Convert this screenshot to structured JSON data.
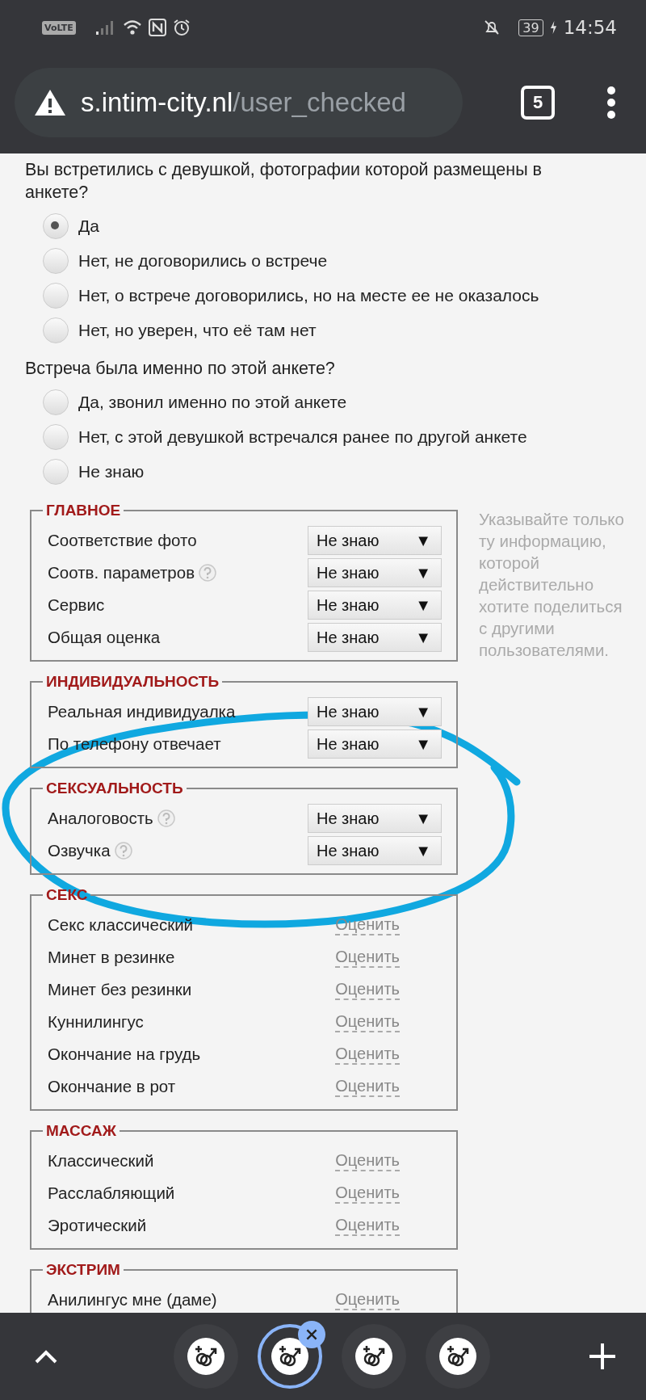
{
  "status_bar": {
    "network_badge": "VoLTE",
    "battery": "39",
    "time": "14:54"
  },
  "address_bar": {
    "domain": "s.intim-city.nl",
    "path": "/user_checked",
    "tab_count": "5"
  },
  "questions": [
    {
      "text": "Вы встретились с девушкой, фотографии которой размещены в анкете?",
      "options": [
        {
          "label": "Да",
          "selected": true
        },
        {
          "label": "Нет, не договорились о встрече",
          "selected": false
        },
        {
          "label": "Нет, о встрече договорились, но на месте ее не оказалось",
          "selected": false
        },
        {
          "label": "Нет, но уверен, что её там нет",
          "selected": false
        }
      ]
    },
    {
      "text": "Встреча была именно по этой анкете?",
      "options": [
        {
          "label": "Да, звонил именно по этой анкете",
          "selected": false
        },
        {
          "label": "Нет, с этой девушкой встречался ранее по другой анкете",
          "selected": false
        },
        {
          "label": "Не знаю",
          "selected": false
        }
      ]
    }
  ],
  "side_note": "Указывайте только ту информацию, которой действительно хотите поделиться с другими пользователями.",
  "sections": [
    {
      "title": "ГЛАВНОЕ",
      "rows": [
        {
          "label": "Соответствие фото",
          "kind": "select",
          "value": "Не знаю",
          "arrow": "▼"
        },
        {
          "label": "Соотв. параметров",
          "help": true,
          "kind": "select",
          "value": "Не знаю",
          "arrow": "▼"
        },
        {
          "label": "Сервис",
          "kind": "select",
          "value": "Не знаю",
          "arrow": "▼"
        },
        {
          "label": "Общая оценка",
          "kind": "select",
          "value": "Не знаю",
          "arrow": "▼"
        }
      ]
    },
    {
      "title": "ИНДИВИДУАЛЬНОСТЬ",
      "rows": [
        {
          "label": "Реальная индивидуалка",
          "kind": "select",
          "value": "Не знаю",
          "arrow": "▼"
        },
        {
          "label": "По телефону отвечает",
          "kind": "select",
          "value": "Не знаю",
          "arrow": "▼"
        }
      ]
    },
    {
      "title": "СЕКСУАЛЬНОСТЬ",
      "rows": [
        {
          "label": "Аналоговость",
          "help": true,
          "kind": "select",
          "value": "Не знаю",
          "arrow": "▼"
        },
        {
          "label": "Озвучка",
          "help": true,
          "kind": "select",
          "value": "Не знаю",
          "arrow": "▼"
        }
      ]
    },
    {
      "title": "СЕКС",
      "rows": [
        {
          "label": "Секс классический",
          "kind": "rate",
          "value": "Оценить"
        },
        {
          "label": "Минет в резинке",
          "kind": "rate",
          "value": "Оценить"
        },
        {
          "label": "Минет без резинки",
          "kind": "rate",
          "value": "Оценить"
        },
        {
          "label": "Куннилингус",
          "kind": "rate",
          "value": "Оценить"
        },
        {
          "label": "Окончание на грудь",
          "kind": "rate",
          "value": "Оценить"
        },
        {
          "label": "Окончание в рот",
          "kind": "rate",
          "value": "Оценить"
        }
      ]
    },
    {
      "title": "МАССАЖ",
      "rows": [
        {
          "label": "Классический",
          "kind": "rate",
          "value": "Оценить"
        },
        {
          "label": "Расслабляющий",
          "kind": "rate",
          "value": "Оценить"
        },
        {
          "label": "Эротический",
          "kind": "rate",
          "value": "Оценить"
        }
      ]
    },
    {
      "title": "ЭКСТРИМ",
      "rows": [
        {
          "label": "Анилингус мне (даме)",
          "kind": "rate",
          "value": "Оценить"
        }
      ]
    }
  ],
  "tab_strip": {
    "tabs": [
      {
        "selected": false
      },
      {
        "selected": true
      },
      {
        "selected": false
      },
      {
        "selected": false
      }
    ]
  }
}
